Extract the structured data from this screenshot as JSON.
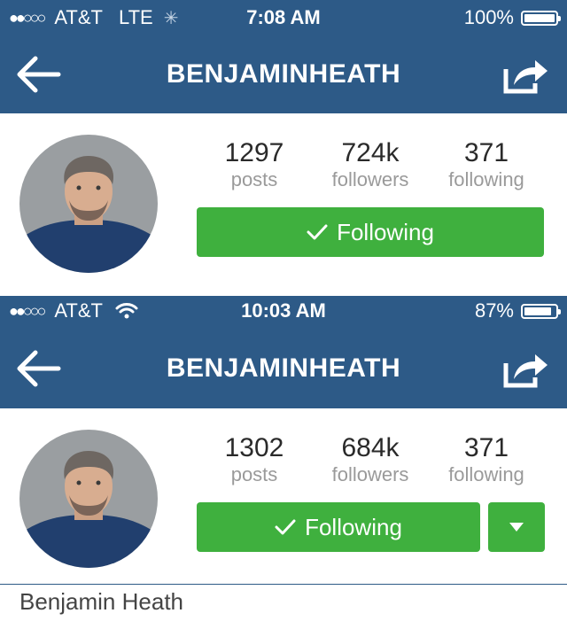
{
  "screens": [
    {
      "status": {
        "signal": "●●○○○",
        "carrier": "AT&T",
        "network": "LTE",
        "time": "7:08 AM",
        "battery_text": "100%",
        "battery_level": 1.0
      },
      "nav": {
        "title": "BENJAMINHEATH",
        "back_icon": "back-arrow-icon",
        "share_icon": "share-icon"
      },
      "stats": [
        {
          "value": "1297",
          "label": "posts"
        },
        {
          "value": "724k",
          "label": "followers"
        },
        {
          "value": "371",
          "label": "following"
        }
      ],
      "follow_label": "Following"
    },
    {
      "status": {
        "signal": "●●○○○",
        "carrier": "AT&T",
        "time": "10:03 AM",
        "battery_text": "87%",
        "battery_level": 0.87
      },
      "nav": {
        "title": "BENJAMINHEATH",
        "back_icon": "back-arrow-icon",
        "share_icon": "share-icon"
      },
      "stats": [
        {
          "value": "1302",
          "label": "posts"
        },
        {
          "value": "684k",
          "label": "followers"
        },
        {
          "value": "371",
          "label": "following"
        }
      ],
      "follow_label": "Following",
      "full_name": "Benjamin Heath"
    }
  ],
  "colors": {
    "header_blue": "#2d5a87",
    "follow_green": "#3fb03e"
  }
}
